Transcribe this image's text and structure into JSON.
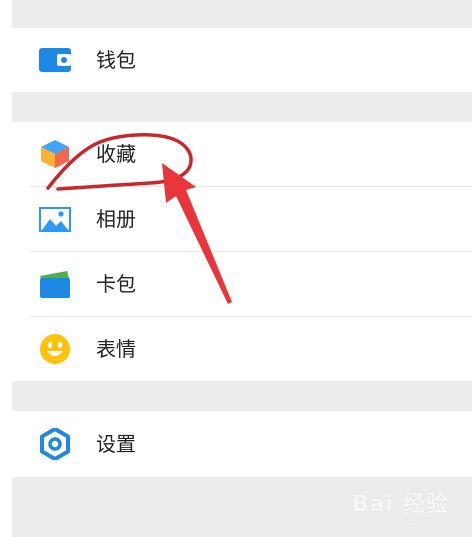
{
  "menu": {
    "items": [
      {
        "label": "钱包",
        "icon": "wallet-icon"
      },
      {
        "label": "收藏",
        "icon": "favorites-cube-icon"
      },
      {
        "label": "相册",
        "icon": "album-icon"
      },
      {
        "label": "卡包",
        "icon": "card-pack-icon"
      },
      {
        "label": "表情",
        "icon": "emoji-icon"
      },
      {
        "label": "设置",
        "icon": "settings-gear-icon"
      }
    ]
  },
  "watermark": {
    "text": "Bai 经验",
    "url": "jingyan.baidu.com"
  },
  "colors": {
    "background": "#ececec",
    "row": "#ffffff",
    "text": "#222222",
    "annotation_red": "#e8363a",
    "blue_icon": "#1e88e5"
  }
}
